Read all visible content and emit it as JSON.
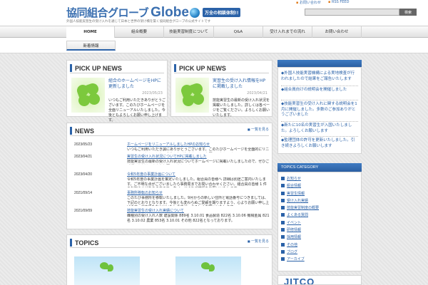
{
  "header": {
    "logo_jp": "協同組合グローブ",
    "logo_en": "Globe",
    "slogan": "万全の相談体制!!",
    "tagline": "外国人技能実習生の受け入れを通じて日本と世界の架け橋を築く協同組合グローブの公式サイトです",
    "toplinks": [
      "お問い合わせ",
      "RSS FEED"
    ],
    "search_button": "検索"
  },
  "nav": {
    "items": [
      "HOME",
      "組合概要",
      "技能実習制度について",
      "Q&A",
      "受け入れまでの流れ",
      "お問い合わせ"
    ],
    "active_index": 0
  },
  "subnav": {
    "item": "新着情報"
  },
  "pickup": [
    {
      "title": "PICK UP NEWS",
      "headline": "組合のホームページをHPに更新しました",
      "date": "2023/05/23",
      "text": "いつもご利用いただきありがとうございます。このたびホームページを全面リニューアルいたしました。今後ともよろしくお願い申し上げます。"
    },
    {
      "title": "PICK UP NEWS",
      "headline": "実習生の受け入れ情報をHPに掲載しました",
      "date": "2023/04/21",
      "text": "技能実習生の最新の受け入れ状況を掲載いたしました。詳しくは各ページをご覧ください。よろしくお願いいたします。"
    }
  ],
  "news": {
    "title": "NEWS",
    "more": "一覧を見る",
    "rows": [
      {
        "date": "2023/05/23",
        "link": "ホームページをリニューアルしましたHPのお知らせ",
        "body": "いつもご利用いただき誠にありがとうございます。このたびホームページを全面的にリニューアルいたしました。今後ともどうぞよろしくお願いいたします。"
      },
      {
        "date": "2023/04/21",
        "link": "実習生の受け入れ状況についてHPに掲載しました",
        "body": "技能実習生の最新の受け入れ状況についてホームページに掲載いたしましたので、ぜひご確認いただけますようお願いいたします。"
      },
      {
        "date": "2023/04/20",
        "link": "令和5年度の事業計画について",
        "body": "令和5年度の事業計画を策定いたしました。組合員の皆様へ 詳細は別途ご案内いたします。ご不明な点がございましたら事務局までお問い合わせください。組合員の皆様 1 件のお知らせがありますので、各ページよりご確認をお願いいたします。"
      },
      {
        "date": "2021/09/14",
        "link": "事務所移転のお知らせ",
        "body": "このたび事務所を移転いたしました。9月からの新しい住所と電話番号につきましては、下記のとおりとなります。今後とも変わらぬご愛顧を賜りますよう、心よりお願い申し上げます。ご不便をおかけいたしますが、よろしくお願いいたします。"
      },
      {
        "date": "2021/09/09",
        "link": "技能実習生の受け入れ実績について",
        "body": "職種別の受け入れ人数 建設関係 889名 3.10.01 食品製造 822名 3.10.06 機械金属 821名 3.10.02 農業 853名 3.10.01 その他 822名となっております。"
      }
    ]
  },
  "topics": {
    "title": "TOPICS",
    "more": "一覧を見る"
  },
  "sidebar": {
    "news_items": [
      "◆外国人技能実習機構による実地検査が行われましたので結果をご報告いたします",
      "◆組合員向けの説明会を開催しました",
      "◆技能実習生の受け入れに関する説明会を1月に開催しました。多数のご参加ありがとうございました",
      "◆新たに10名の実習生が入国いたしました。よろしくお願いします",
      "◆監理団体の許可を更新いたしました。引き続きよろしくお願いします"
    ],
    "category_title": "TOPICS CATEGORY",
    "categories": [
      "お知らせ",
      "組合情報",
      "実習生情報",
      "受け入れ実績",
      "技能実習制度の概要",
      "よくある質問",
      "イベント",
      "研修情報",
      "採用情報",
      "その他",
      "ブログ",
      "アーカイブ"
    ],
    "banner": "JITCO"
  },
  "colors": {
    "accent": "#2b62a8",
    "bg": "#e9e9e9"
  }
}
